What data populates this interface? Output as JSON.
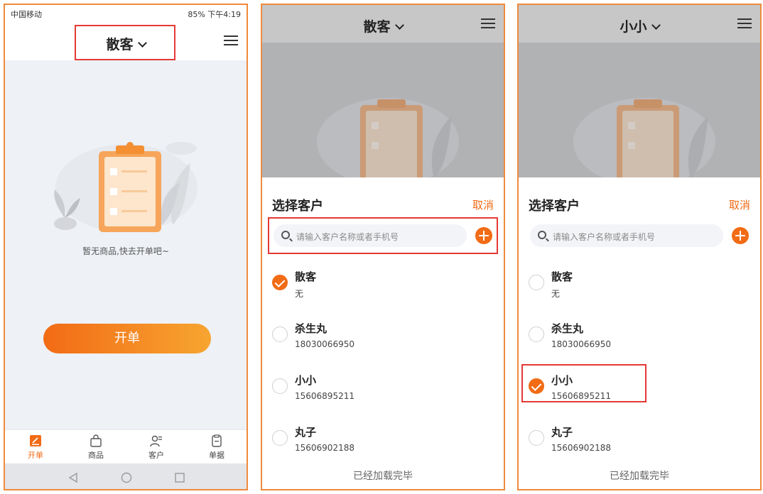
{
  "panel1": {
    "status_left": "中国移动",
    "status_right": "85% 下午4:19",
    "title": "散客",
    "empty_text": "暂无商品,快去开单吧~",
    "open_button": "开单",
    "tabs": [
      {
        "label": "开单",
        "icon": "open-order-icon",
        "active": true
      },
      {
        "label": "商品",
        "icon": "bag-icon",
        "active": false
      },
      {
        "label": "客户",
        "icon": "customer-icon",
        "active": false
      },
      {
        "label": "单据",
        "icon": "document-icon",
        "active": false
      }
    ],
    "nav_buttons": [
      "back-icon",
      "home-icon",
      "recents-icon"
    ]
  },
  "panel2": {
    "title": "散客",
    "sheet_title": "选择客户",
    "cancel": "取消",
    "search_placeholder": "请输入客户名称或者手机号",
    "customers": [
      {
        "name": "散客",
        "phone": "无",
        "selected": true
      },
      {
        "name": "杀生丸",
        "phone": "18030066950",
        "selected": false
      },
      {
        "name": "小小",
        "phone": "15606895211",
        "selected": false
      },
      {
        "name": "丸子",
        "phone": "15606902188",
        "selected": false
      }
    ],
    "footer": "已经加载完毕"
  },
  "panel3": {
    "title": "小小",
    "sheet_title": "选择客户",
    "cancel": "取消",
    "search_placeholder": "请输入客户名称或者手机号",
    "customers": [
      {
        "name": "散客",
        "phone": "无",
        "selected": false
      },
      {
        "name": "杀生丸",
        "phone": "18030066950",
        "selected": false
      },
      {
        "name": "小小",
        "phone": "15606895211",
        "selected": true
      },
      {
        "name": "丸子",
        "phone": "15606902188",
        "selected": false
      }
    ],
    "footer": "已经加载完毕"
  },
  "colors": {
    "accent": "#f26b15",
    "highlight": "#e53935",
    "frame": "#f08a3c"
  }
}
